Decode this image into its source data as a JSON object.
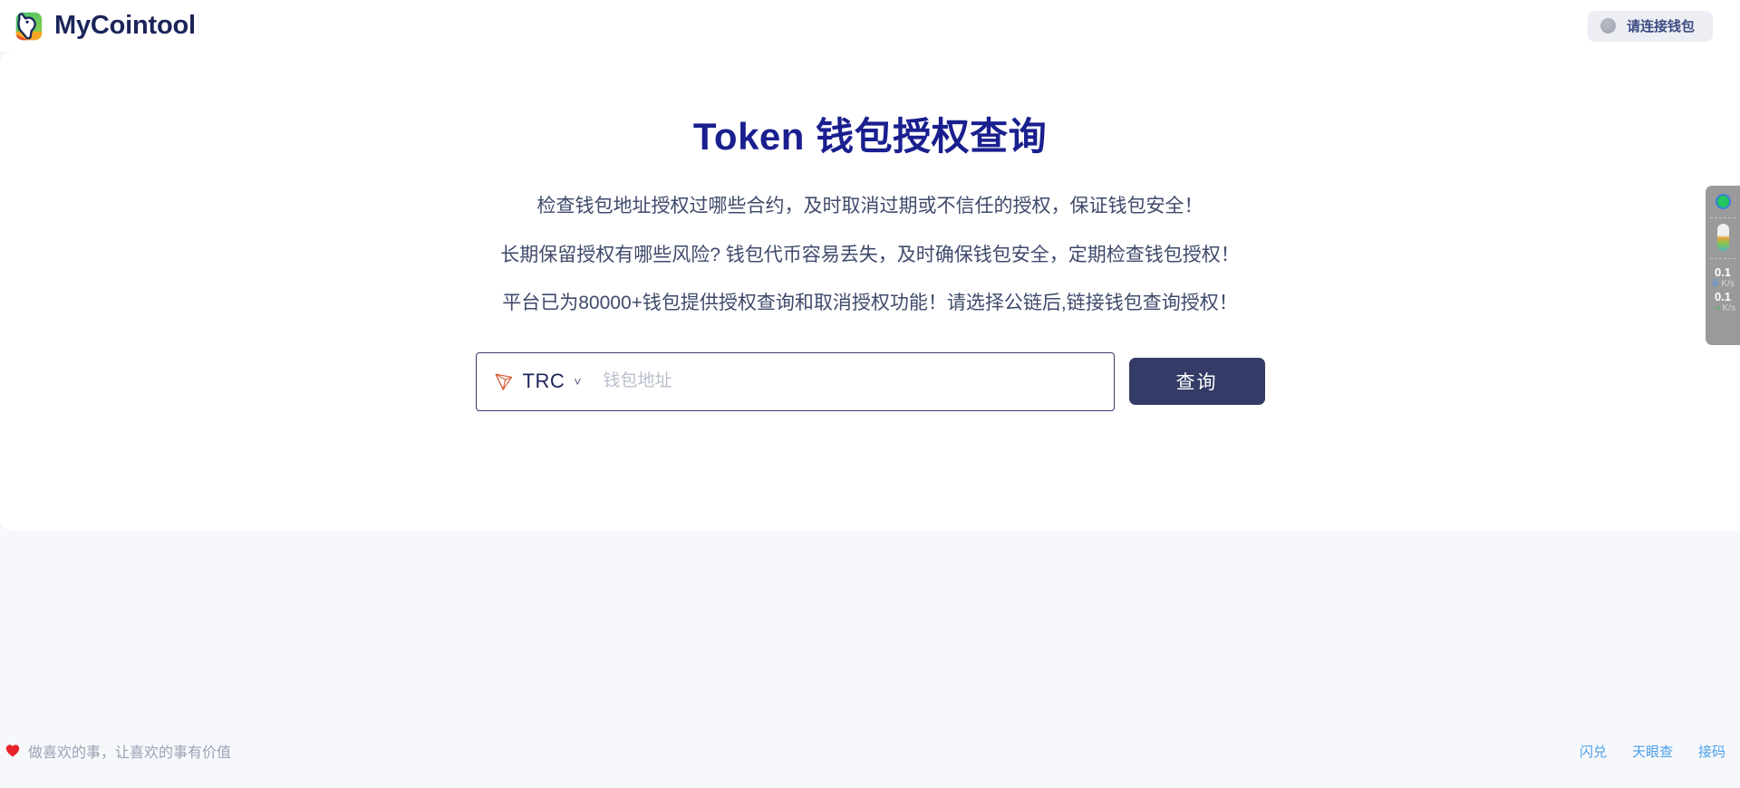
{
  "header": {
    "brand_name": "MyCointool",
    "brand_logo_icon": "dog-head-logo-icon",
    "connect_wallet_label": "请连接钱包",
    "connect_wallet_status_icon": "gray-status-dot-icon"
  },
  "main": {
    "title": "Token 钱包授权查询",
    "descriptions": [
      "检查钱包地址授权过哪些合约，及时取消过期或不信任的授权，保证钱包安全！",
      "长期保留授权有哪些风险? 钱包代币容易丢失，及时确保钱包安全，定期检查钱包授权！",
      "平台已为80000+钱包提供授权查询和取消授权功能！请选择公链后,链接钱包查询授权！"
    ],
    "search": {
      "chain_label": "TRC",
      "chain_icon": "tron-logo-icon",
      "chevron_icon": "chevron-down-icon",
      "address_placeholder": "钱包地址",
      "address_value": "",
      "query_button_label": "查询"
    }
  },
  "footer": {
    "heart_icon": "heart-icon",
    "slogan": "做喜欢的事，让喜欢的事有价值",
    "links": [
      "闪兑",
      "天眼查",
      "接码"
    ]
  },
  "network_widget": {
    "status_icon": "green-status-circle-icon",
    "pill_icon": "capsule-gradient-icon",
    "upload_value": "0.1",
    "upload_unit": "K/s",
    "upload_icon": "arrow-up-icon",
    "download_value": "0.1",
    "download_unit": "K/s",
    "download_icon": "arrow-down-icon"
  },
  "colors": {
    "brand_navy": "#1b2559",
    "title_blue": "#1a1f8f",
    "button_navy": "#343b66",
    "link_blue": "#4a9eea",
    "page_bg": "#f7f8fb"
  }
}
